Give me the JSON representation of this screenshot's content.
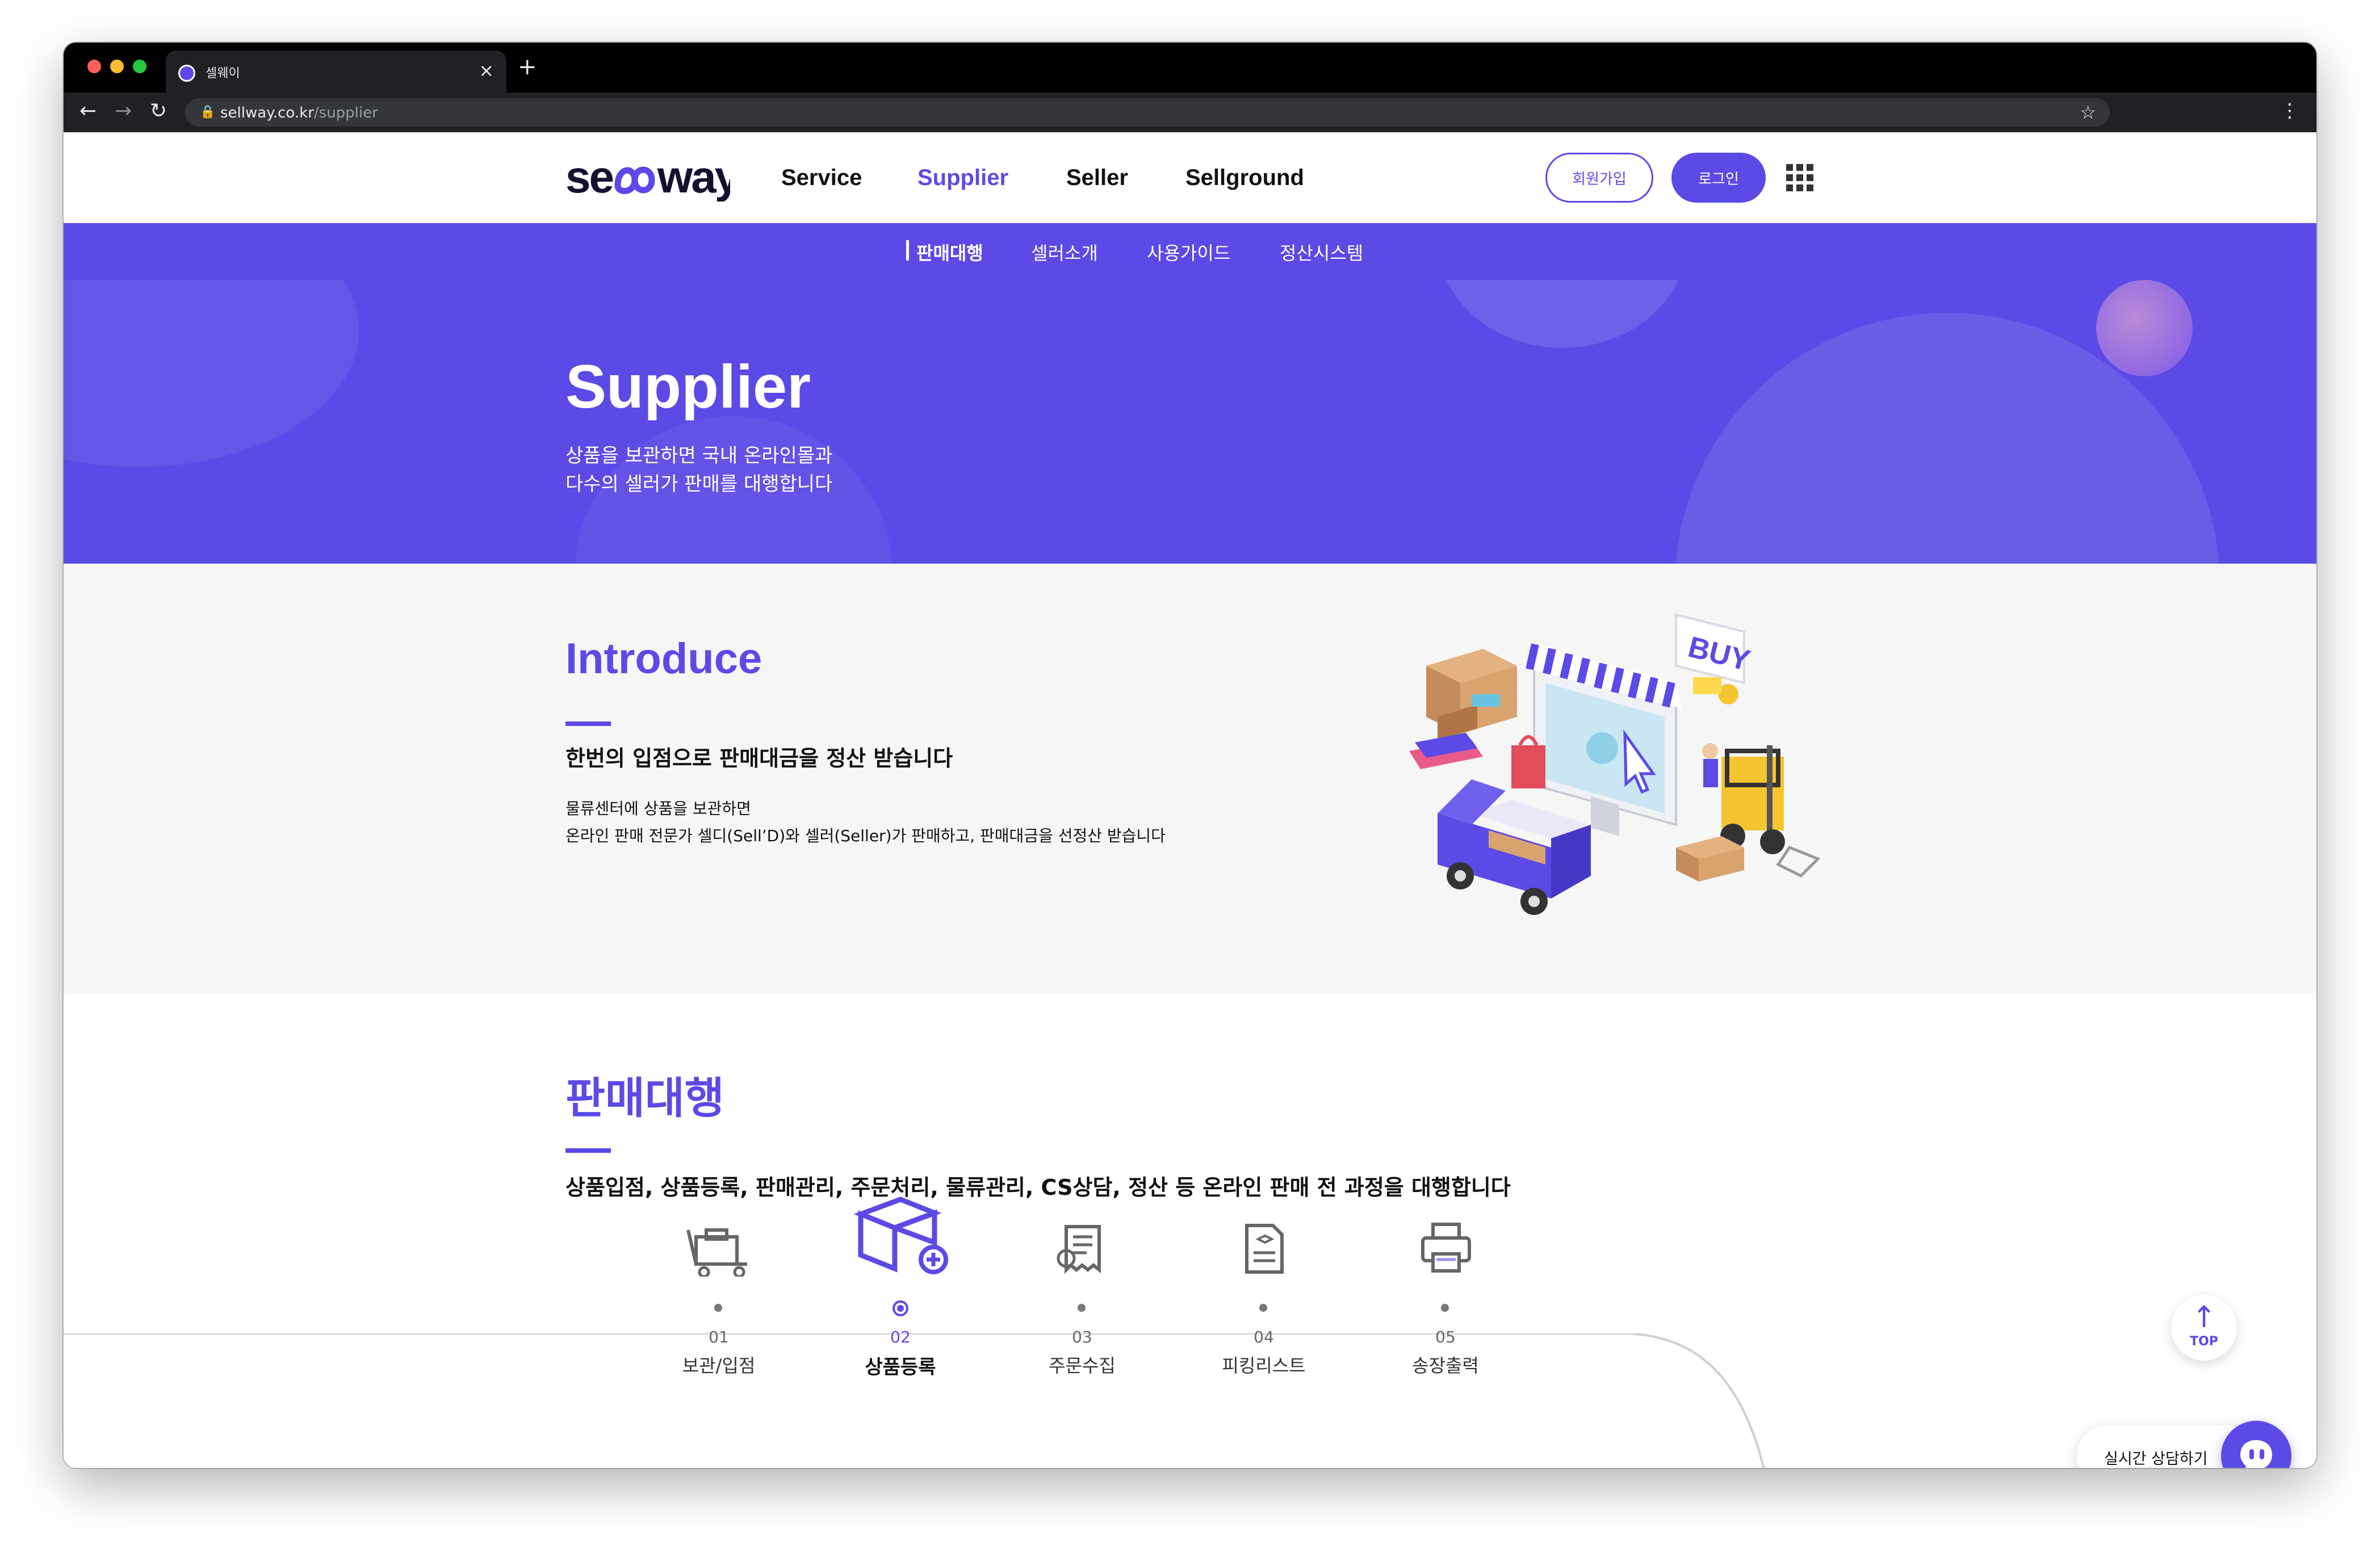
{
  "browser": {
    "tab_title": "셀웨이",
    "url_host": "sellway.co.kr",
    "url_path": "/supplier"
  },
  "header": {
    "logo": "sellway",
    "nav": [
      "Service",
      "Supplier",
      "Seller",
      "Sellground"
    ],
    "active_nav": "Supplier",
    "join_label": "회원가입",
    "login_label": "로그인"
  },
  "subnav": {
    "items": [
      "판매대행",
      "셀러소개",
      "사용가이드",
      "정산시스템"
    ],
    "active": "판매대행"
  },
  "hero": {
    "title": "Supplier",
    "line1": "상품을 보관하면 국내 온라인몰과",
    "line2": "다수의 셀러가 판매를 대행합니다"
  },
  "intro": {
    "title": "Introduce",
    "subtitle": "한번의 입점으로 판매대금을 정산 받습니다",
    "body1": "물류센터에 상품을 보관하면",
    "body2": "온라인 판매 전문가 셀디(Sell’D)와 셀러(Seller)가 판매하고, 판매대금을 선정산 받습니다",
    "illustration_text": "BUY"
  },
  "agency": {
    "title": "판매대행",
    "subtitle": "상품입점, 상품등록, 판매관리, 주문처리, 물류관리, CS상담, 정산 등 온라인 판매 전 과정을 대행합니다",
    "steps": [
      {
        "num": "01",
        "label": "보관/입점",
        "icon": "warehouse-cart-icon"
      },
      {
        "num": "02",
        "label": "상품등록",
        "icon": "box-add-icon"
      },
      {
        "num": "03",
        "label": "주문수집",
        "icon": "receipt-icon"
      },
      {
        "num": "04",
        "label": "피킹리스트",
        "icon": "document-list-icon"
      },
      {
        "num": "05",
        "label": "송장출력",
        "icon": "printer-icon"
      }
    ],
    "active_step": 1
  },
  "floating": {
    "top_label": "TOP",
    "chat_label": "실시간 상담하기"
  },
  "colors": {
    "brand": "#5b4ae6",
    "section_bg": "#f6f6f6",
    "text_dark": "#111111"
  }
}
